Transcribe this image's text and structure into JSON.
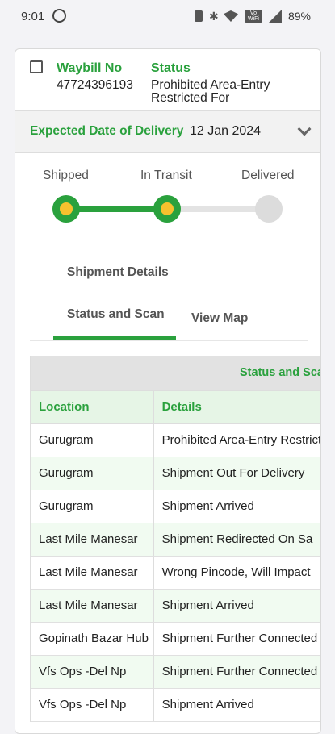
{
  "status_bar": {
    "time": "9:01",
    "battery": "89%",
    "volte": "Vo WiFi"
  },
  "header": {
    "waybill_label": "Waybill No",
    "waybill_value": "47724396193",
    "status_label": "Status",
    "status_value": "Prohibited Area-Entry Restricted For"
  },
  "edd": {
    "label": "Expected Date of Delivery",
    "value": "12 Jan 2024"
  },
  "progress": {
    "steps": [
      "Shipped",
      "In Transit",
      "Delivered"
    ],
    "completed_steps": 2
  },
  "tabs": [
    {
      "label": "Shipment Details"
    },
    {
      "label": "Status and Scan",
      "active": true
    },
    {
      "label": "View Map"
    }
  ],
  "table": {
    "title": "Status and Scan",
    "columns": [
      "Location",
      "Details"
    ],
    "rows": [
      [
        "Gurugram",
        "Prohibited Area-Entry Restricted For"
      ],
      [
        "Gurugram",
        "Shipment Out For Delivery"
      ],
      [
        "Gurugram",
        "Shipment Arrived"
      ],
      [
        "Last Mile Manesar",
        "Shipment Redirected On Sa"
      ],
      [
        "Last Mile Manesar",
        "Wrong Pincode, Will Impact"
      ],
      [
        "Last Mile Manesar",
        "Shipment Arrived"
      ],
      [
        "Gopinath Bazar Hub",
        "Shipment Further Connected"
      ],
      [
        "Vfs Ops -Del Np",
        "Shipment Further Connected"
      ],
      [
        "Vfs Ops -Del Np",
        "Shipment Arrived"
      ]
    ]
  },
  "colors": {
    "accent": "#2aa13d",
    "step_dot": "#f6c12e",
    "row_alt": "#f1fbf1"
  }
}
